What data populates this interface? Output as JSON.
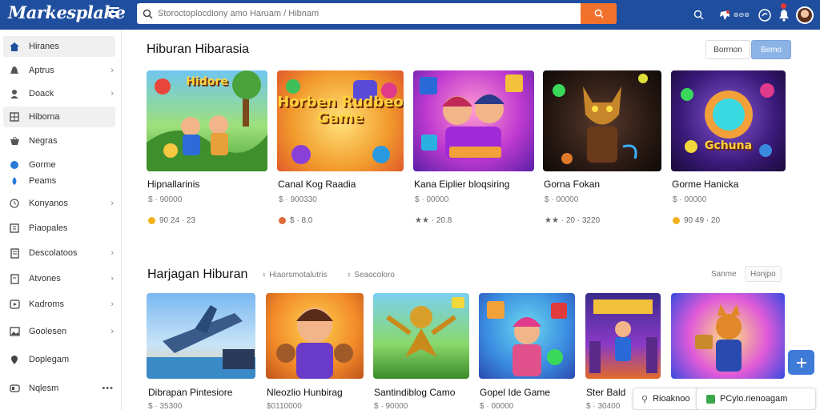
{
  "header": {
    "logo": "Markesplake",
    "search_placeholder": "Storoctoplocdiony amo Haruam / Hibnam",
    "status_text": "⊜⊝⊜",
    "colors": {
      "bar": "#1f4e9e",
      "search_button": "#f2722c",
      "accent": "#3e7bd6"
    }
  },
  "sidebar": {
    "items": [
      {
        "label": "Hiranes",
        "icon": "home-icon",
        "chevron": false
      },
      {
        "label": "Aptrus",
        "icon": "bell-icon",
        "chevron": true
      },
      {
        "label": "Doack",
        "icon": "user-icon",
        "chevron": true
      },
      {
        "label": "Hiborna",
        "icon": "grid-icon",
        "chevron": false
      },
      {
        "label": "Negras",
        "icon": "basket-icon",
        "chevron": false
      },
      {
        "label": "Gorme",
        "icon": "chat-icon",
        "chevron": false
      },
      {
        "label": "Peams",
        "icon": "drop-icon",
        "chevron": false
      },
      {
        "label": "Konyanos",
        "icon": "clock-icon",
        "chevron": true
      },
      {
        "label": "Piaopales",
        "icon": "tag-icon",
        "chevron": false
      },
      {
        "label": "Descolatoos",
        "icon": "list-icon",
        "chevron": true
      },
      {
        "label": "Atvones",
        "icon": "doc-icon",
        "chevron": true
      },
      {
        "label": "Kadroms",
        "icon": "play-icon",
        "chevron": true
      },
      {
        "label": "Goolesen",
        "icon": "image-icon",
        "chevron": true
      },
      {
        "label": "Doplegam",
        "icon": "pin-icon",
        "chevron": false
      },
      {
        "label": "Nqlesm",
        "icon": "lock-icon",
        "chevron": false
      }
    ]
  },
  "section1": {
    "title": "Hiburan Hibarasia",
    "toggle": [
      "Borrnon",
      "Bemo"
    ],
    "cards": [
      {
        "title": "Hipnallarinis",
        "price": "$ · 90000",
        "rating": "90 24 · 23",
        "img_text": "Hidore",
        "coin": "gold"
      },
      {
        "title": "Canal Kog Raadia",
        "price": "$ · 900330",
        "rating": "$ · 8.0",
        "img_text": "Horben Rudbeo Game",
        "coin": "red"
      },
      {
        "title": "Kana Eiplier bloqsiring",
        "price": "$ · 00000",
        "rating": "★★ · 20.8",
        "img_text": "",
        "coin": "stars"
      },
      {
        "title": "Gorna Fokan",
        "price": "$ · 00000",
        "rating": "★★ · 20 · 3220",
        "img_text": "",
        "coin": "stars-gold"
      },
      {
        "title": "Gorme Hanicka",
        "price": "$ · 00000",
        "rating": "90 49 · 20",
        "img_text": "Gchuna",
        "coin": "gold"
      }
    ]
  },
  "section2": {
    "title": "Harjagan Hiburan",
    "meta1": "♁ Hiaorsmotalutris",
    "meta2": "♁ Seaocoloro",
    "chips": [
      "Sanme",
      "Honjpo"
    ],
    "cards": [
      {
        "title": "Dibrapan Pintesiore",
        "price": "$ · 35300"
      },
      {
        "title": "Nleozlio Hunbirag",
        "price": "$0110000"
      },
      {
        "title": "Santindiblog Camo",
        "price": "$ · 90000"
      },
      {
        "title": "Gopel Ide Game",
        "price": "$ · 00000"
      },
      {
        "title": "Ster Bald",
        "price": "$ · 30400"
      },
      {
        "title": "",
        "price": ""
      }
    ]
  },
  "toasts": [
    {
      "label": "Rioaknoo",
      "icon": "user-icon"
    },
    {
      "label": "PCylo.rienoagam",
      "icon": "app-icon"
    }
  ]
}
